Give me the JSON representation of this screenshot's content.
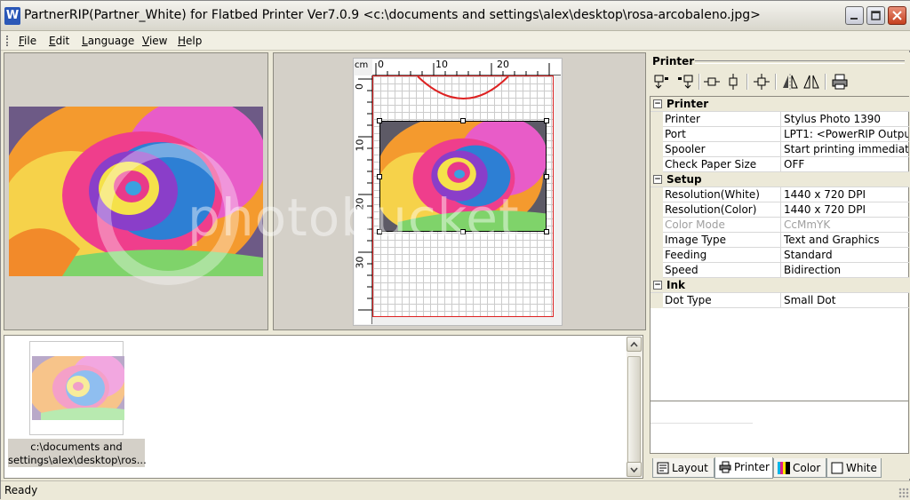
{
  "window": {
    "title": "PartnerRIP(Partner_White) for Flatbed Printer Ver7.0.9 <c:\\documents and settings\\alex\\desktop\\rosa-arcobaleno.jpg>",
    "app_icon_letter": "W"
  },
  "menu": [
    "File",
    "Edit",
    "Language",
    "View",
    "Help"
  ],
  "ruler": {
    "unit": "cm",
    "top_ticks": [
      "0",
      "10",
      "20"
    ],
    "left_ticks": [
      "0",
      "10",
      "20",
      "30"
    ]
  },
  "watermark": {
    "text": "photobucket"
  },
  "thumbnails": [
    {
      "caption_line1": "c:\\documents and",
      "caption_line2": "settings\\alex\\desktop\\ros..."
    }
  ],
  "panel": {
    "title": "Printer",
    "toolbar_icons": [
      "align-top-left-icon",
      "align-top-right-icon",
      "center-horizontal-icon",
      "center-vertical-icon",
      "center-both-icon",
      "flip-horizontal-icon",
      "mirror-icon",
      "print-icon"
    ],
    "categories": [
      {
        "name": "Printer",
        "rows": [
          {
            "key": "Printer",
            "value": "Stylus Photo 1390"
          },
          {
            "key": "Port",
            "value": "LPT1:  <PowerRIP Output"
          },
          {
            "key": "Spooler",
            "value": "Start printing immediately"
          },
          {
            "key": "Check Paper Size",
            "value": "OFF"
          }
        ]
      },
      {
        "name": "Setup",
        "rows": [
          {
            "key": "Resolution(White)",
            "value": "1440 x 720 DPI"
          },
          {
            "key": "Resolution(Color)",
            "value": "1440 x 720 DPI"
          },
          {
            "key": "Color Mode",
            "value": "CcMmYK",
            "disabled": true
          },
          {
            "key": "Image Type",
            "value": "Text and Graphics"
          },
          {
            "key": "Feeding",
            "value": "Standard"
          },
          {
            "key": "Speed",
            "value": "Bidirection"
          }
        ]
      },
      {
        "name": "Ink",
        "rows": [
          {
            "key": "Dot Type",
            "value": "Small Dot"
          }
        ]
      }
    ],
    "toggle_symbol": "−"
  },
  "tabs": [
    {
      "label": "Layout",
      "icon": "layout-icon"
    },
    {
      "label": "Printer",
      "icon": "printer-icon",
      "active": true
    },
    {
      "label": "Color",
      "icon": "color-bars-icon"
    },
    {
      "label": "White",
      "icon": "white-square-icon"
    }
  ],
  "status": {
    "text": "Ready"
  },
  "colors": {
    "accent_title": "#2a57b7",
    "page_border": "#dd2222",
    "close_button": "#c5401f"
  }
}
